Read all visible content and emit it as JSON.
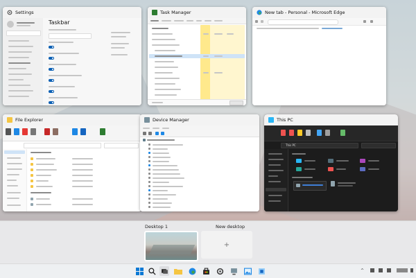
{
  "windows": {
    "settings": {
      "title": "Settings",
      "section_title": "Taskbar",
      "nav_items": [
        "System",
        "Bluetooth & devices",
        "Network & internet",
        "Personalization",
        "Apps",
        "Accounts",
        "Time & language",
        "Gaming",
        "Accessibility",
        "Privacy & security",
        "Windows Update"
      ]
    },
    "task_manager": {
      "title": "Task Manager",
      "tabs": [
        "Processes",
        "Performance",
        "App history",
        "Startup",
        "Users",
        "Details",
        "Services"
      ],
      "rows": [
        "Task Manager",
        "Windows Explorer",
        "Background processes",
        "Application Frame Host",
        "COM Surrogate",
        "CTF Loader",
        "Cortana",
        "Host Process for Windows Tasks"
      ],
      "footer": "Fewer details",
      "end_task": "End task"
    },
    "edge": {
      "title": "New tab - Personal - Microsoft Edge"
    },
    "file_explorer": {
      "title": "File Explorer",
      "folder_label": "Quick access",
      "tree": [
        "Desktop",
        "Downloads",
        "Documents",
        "Pictures",
        "Music",
        "Videos",
        "OneDrive",
        "This PC",
        "Network"
      ]
    },
    "device_manager": {
      "title": "Device Manager",
      "tree": [
        "Audio inputs and outputs",
        "Batteries",
        "Bluetooth",
        "Computer",
        "Disk drives",
        "Display adapters",
        "DVD/CD-ROM drives",
        "Human Interface Devices",
        "IDE ATA/ATAPI controllers",
        "Keyboards",
        "Mice and other pointing devices",
        "Monitors",
        "Network adapters",
        "Print queues",
        "Processors",
        "Security devices",
        "Software devices",
        "Sound, video and game controllers",
        "Storage controllers",
        "System devices",
        "Universal Serial Bus controllers"
      ]
    },
    "this_pc": {
      "title": "This PC",
      "path": "This PC"
    }
  },
  "desktops": {
    "desktop1_label": "Desktop 1",
    "new_desktop_label": "New desktop",
    "new_desktop_symbol": "+"
  },
  "taskbar": {
    "icons": [
      "windows-start",
      "search",
      "task-view",
      "file-explorer",
      "edge",
      "store",
      "settings",
      "device-manager",
      "photos"
    ],
    "accent": "#0a5fb4"
  }
}
